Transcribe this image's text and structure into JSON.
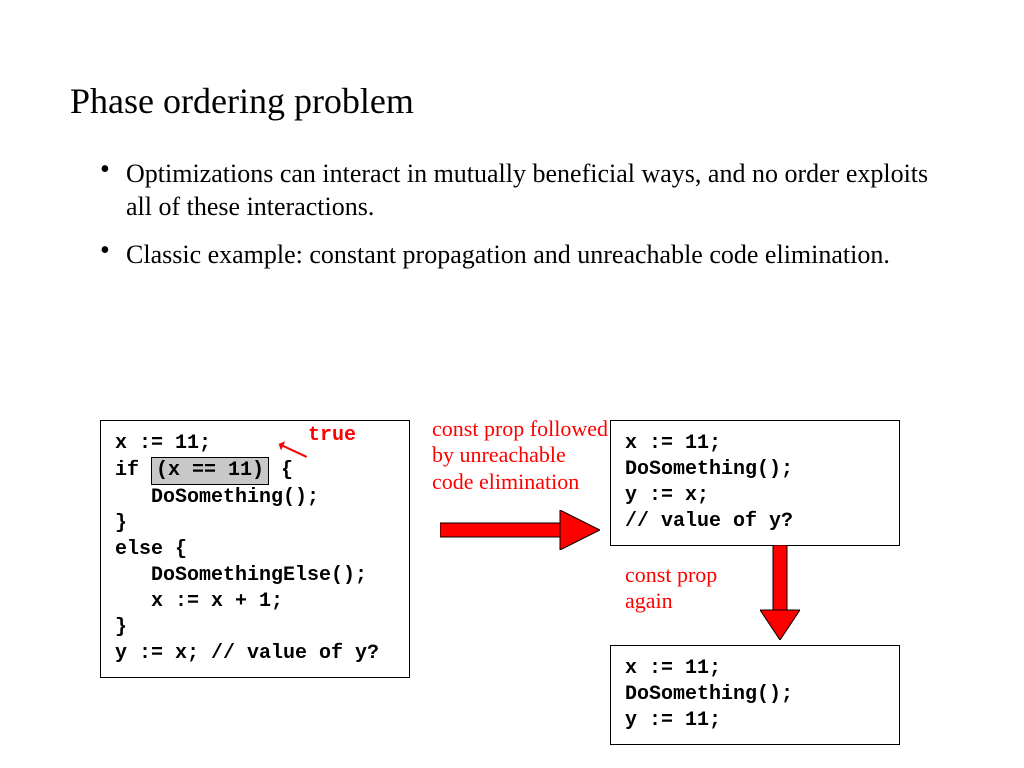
{
  "title": "Phase ordering problem",
  "bullets": [
    "Optimizations can interact in mutually beneficial ways, and no order exploits all of these interactions.",
    "Classic example: constant propagation and unreachable code elimination."
  ],
  "codeLeft": {
    "l1": "x := 11;",
    "l2a": "if ",
    "l2cond": "(x == 11)",
    "l2b": " {",
    "l3": "   DoSomething();",
    "l4": "}",
    "l5": "else {",
    "l6": "   DoSomethingElse();",
    "l7": "   x := x + 1;",
    "l8": "}",
    "l9": "y := x; // value of y?"
  },
  "codeTop": {
    "l1": "x := 11;",
    "l2": "DoSomething();",
    "l3": "y := x;",
    "l4": "// value of y?"
  },
  "codeBot": {
    "l1": "x := 11;",
    "l2": "DoSomething();",
    "l3": "y := 11;"
  },
  "annos": {
    "trueLabel": "true",
    "step1": "const prop followed by unreachable code elimination",
    "step2": "const prop again"
  }
}
